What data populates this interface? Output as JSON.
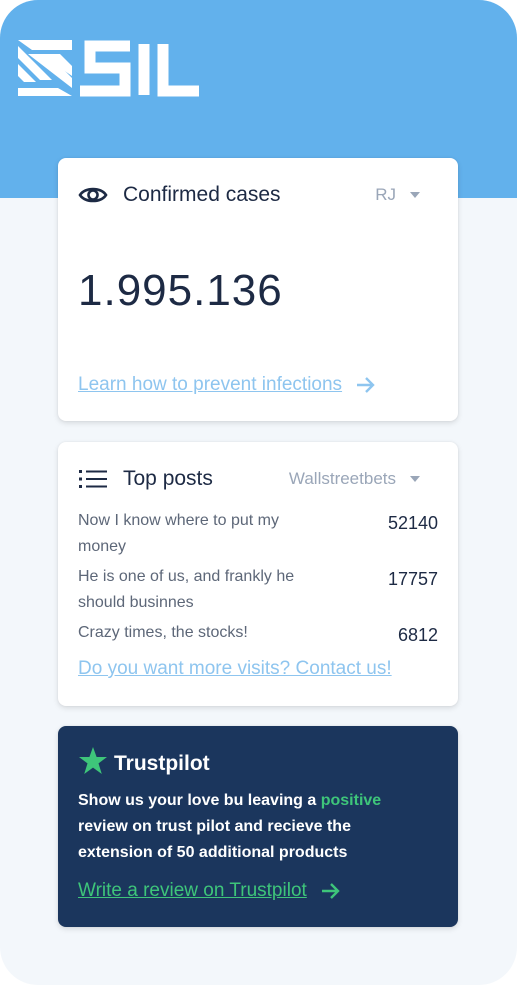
{
  "brand": {
    "logo_text": "SIL",
    "colors": {
      "hero": "#62b1ec",
      "dark": "#1b365d",
      "accent_green": "#3ec57a",
      "link_blue": "#8ec5ef"
    }
  },
  "cases": {
    "title": "Confirmed cases",
    "region": "RJ",
    "count": "1.995.136",
    "link": "Learn how to prevent infections",
    "icon": "eye-icon"
  },
  "posts": {
    "title": "Top posts",
    "source": "Wallstreetbets",
    "icon": "list-icon",
    "items": [
      {
        "title": "Now I know where to put my money",
        "count": "52140"
      },
      {
        "title": "He is one of us, and frankly he should businnes",
        "count": "17757"
      },
      {
        "title": "Crazy times, the stocks!",
        "count": "6812"
      }
    ],
    "link": "Do you want more visits? Contact us!"
  },
  "trustpilot": {
    "title": "Trustpilot",
    "icon": "star-icon",
    "text_before": "Show us your love bu leaving a ",
    "text_highlight": "positive",
    "text_after": " review on trust pilot and recieve the extension of 50 additional products",
    "link": "Write a review on Trustpilot"
  }
}
